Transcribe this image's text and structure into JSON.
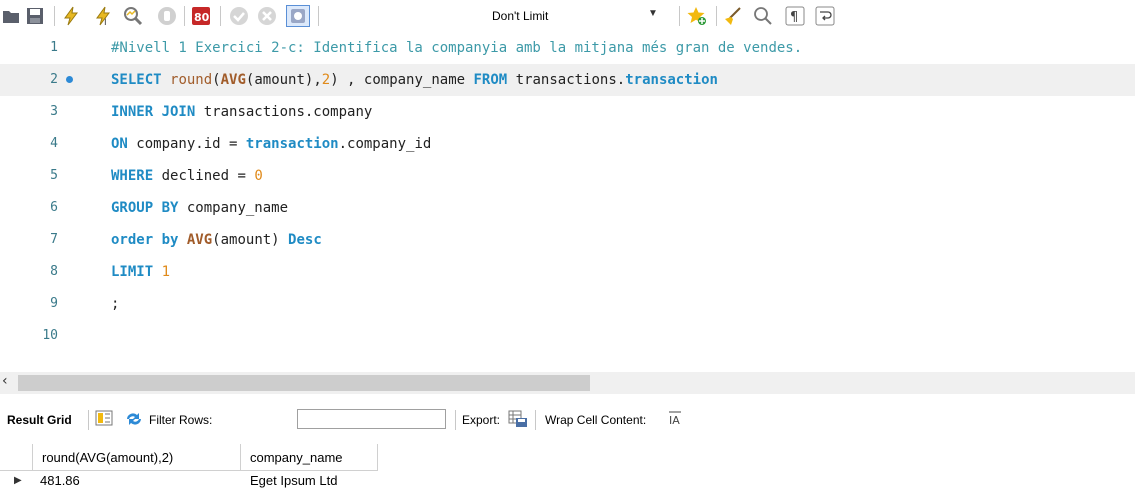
{
  "toolbar": {
    "icons": [
      "open-folder-icon",
      "save-icon",
      "execute-all-icon",
      "execute-current-icon",
      "explain-icon",
      "stop-icon",
      "toggle-errors-icon",
      "commit-icon",
      "rollback-icon",
      "autocommit-icon",
      "add-snippet-icon",
      "beautify-icon",
      "find-icon",
      "invisible-chars-icon",
      "word-wrap-icon"
    ],
    "limit_label": "Don't Limit"
  },
  "editor": {
    "lines": [
      {
        "num": "1"
      },
      {
        "num": "2"
      },
      {
        "num": "3"
      },
      {
        "num": "4"
      },
      {
        "num": "5"
      },
      {
        "num": "6"
      },
      {
        "num": "7"
      },
      {
        "num": "8"
      },
      {
        "num": "9"
      },
      {
        "num": "10"
      }
    ],
    "tokens": {
      "l1_comment": "#Nivell 1 Exercici 2-c: Identifica la companyia amb la mitjana més gran de vendes.",
      "l2_select": "SELECT",
      "l2_round": "round",
      "l2_paren_open": "(",
      "l2_avg": "AVG",
      "l2_arg": "(amount),",
      "l2_two": "2",
      "l2_rest": ") , company_name ",
      "l2_from": "FROM",
      "l2_schema": " transactions.",
      "l2_table": "transaction",
      "l3_join": "INNER JOIN",
      "l3_rest": " transactions.company",
      "l4_on": "ON",
      "l4_mid": " company.id = ",
      "l4_obj": "transaction",
      "l4_rest": ".company_id",
      "l5_where": "WHERE",
      "l5_mid": " declined = ",
      "l5_zero": "0",
      "l6_group": "GROUP BY",
      "l6_rest": " company_name",
      "l7_order": "order by",
      "l7_sp": " ",
      "l7_avg": "AVG",
      "l7_mid": "(amount) ",
      "l7_desc": "Desc",
      "l8_limit": "LIMIT",
      "l8_sp": " ",
      "l8_one": "1",
      "l9_semi": ";"
    }
  },
  "resultbar": {
    "result_grid": "Result Grid",
    "filter_rows": "Filter Rows:",
    "filter_value": "",
    "export": "Export:",
    "wrap": "Wrap Cell Content:"
  },
  "grid": {
    "columns": [
      "round(AVG(amount),2)",
      "company_name"
    ],
    "rows": [
      [
        "481.86",
        "Eget Ipsum Ltd"
      ]
    ]
  }
}
